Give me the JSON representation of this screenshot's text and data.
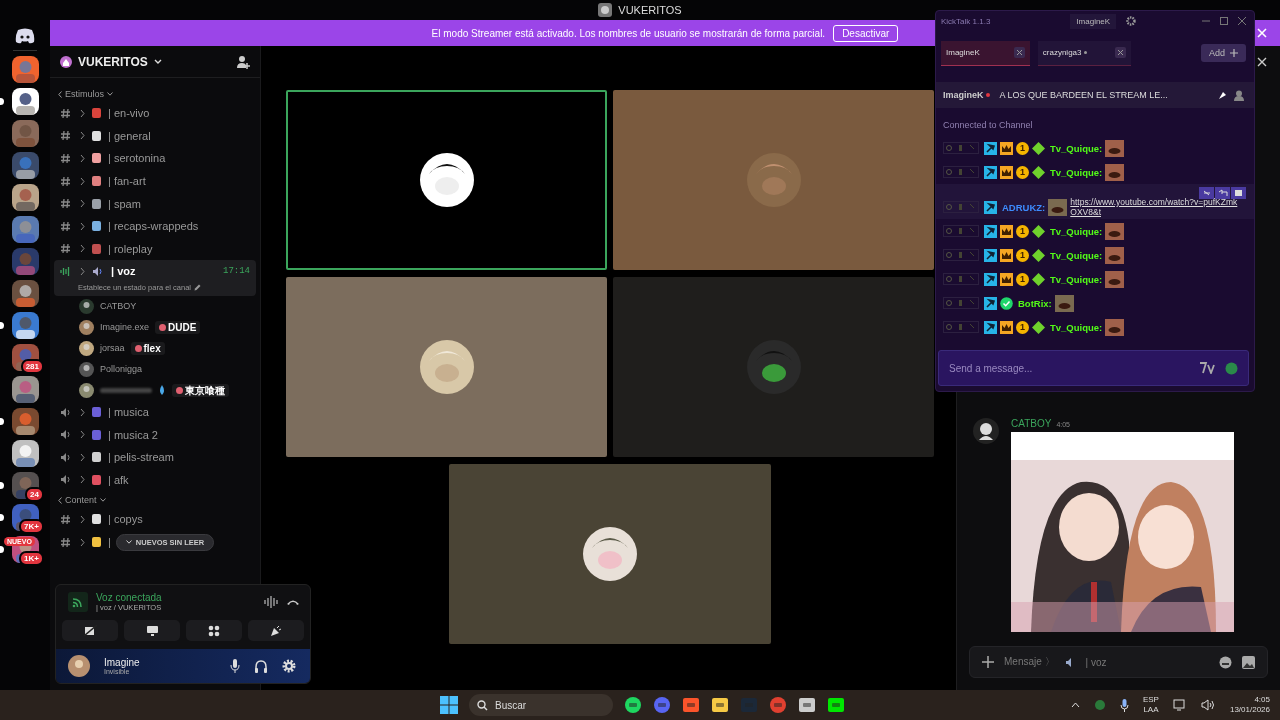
{
  "window": {
    "title": "VUKERITOS"
  },
  "banner": {
    "text": "El modo Streamer está activado. Los nombres de usuario se mostrarán de forma parcial.",
    "button": "Desactivar"
  },
  "servers": [
    {
      "unread": false
    },
    {
      "unread": true
    },
    {
      "unread": false
    },
    {
      "unread": false
    },
    {
      "unread": false
    },
    {
      "unread": false
    },
    {
      "unread": false
    },
    {
      "unread": false
    },
    {
      "unread": true
    },
    {
      "unread": false,
      "badge": "281"
    },
    {
      "unread": false
    },
    {
      "unread": true
    },
    {
      "unread": false
    },
    {
      "unread": true,
      "badge": "24"
    },
    {
      "unread": true,
      "badge": "7K+"
    },
    {
      "unread": true,
      "badge": "1K+"
    }
  ],
  "new_badge": "NUEVO",
  "sidebar": {
    "server": "VUKERITOS",
    "categories": [
      {
        "name": "Estimulos",
        "channels": [
          {
            "kind": "text",
            "name": "| en-vivo",
            "selected": false
          },
          {
            "kind": "text",
            "name": "| general",
            "selected": false
          },
          {
            "kind": "text",
            "name": "| serotonina",
            "selected": false
          },
          {
            "kind": "text",
            "name": "| fan-art",
            "selected": false
          },
          {
            "kind": "text",
            "name": "| spam",
            "selected": false
          },
          {
            "kind": "text",
            "name": "| recaps-wrappeds",
            "selected": false
          },
          {
            "kind": "text",
            "name": "| roleplay",
            "selected": false
          },
          {
            "kind": "voice",
            "name": "| voz",
            "selected": true,
            "time": "17:14",
            "status": "Establece un estado para el canal",
            "members": [
              {
                "kind": "user",
                "name": "CATBOY"
              },
              {
                "kind": "user",
                "name": "Imagine.exe",
                "tag": "DUDE"
              },
              {
                "kind": "user",
                "name": "jorsaa",
                "tag": "flex"
              },
              {
                "kind": "user",
                "name": "Pollonigga"
              },
              {
                "kind": "hidden",
                "tag": "東京喰種"
              }
            ]
          },
          {
            "kind": "voice",
            "name": "| musica",
            "selected": false
          },
          {
            "kind": "voice",
            "name": "| musica 2",
            "selected": false
          },
          {
            "kind": "voice",
            "name": "| pelis-stream",
            "selected": false
          },
          {
            "kind": "voice",
            "name": "| afk",
            "selected": false
          }
        ]
      },
      {
        "name": "Content",
        "channels": [
          {
            "kind": "text",
            "name": "| copys",
            "selected": false
          },
          {
            "kind": "text",
            "name": "|",
            "selected": false
          }
        ]
      }
    ],
    "unread_pill": "NUEVOS SIN LEER",
    "voice_panel": {
      "title": "Voz conectada",
      "channel": "| voz / VUKERITOS"
    },
    "user": {
      "name": "Imagine",
      "status": "Invisible"
    }
  },
  "tiles": [
    {
      "color": "#000000",
      "speaking": true
    },
    {
      "color": "#7a5a3e",
      "speaking": false
    },
    {
      "color": "#7c6d5d",
      "speaking": false
    },
    {
      "color": "#1f1e1c",
      "speaking": false
    },
    {
      "color": "#4a4435",
      "speaking": false
    }
  ],
  "kicktalk": {
    "title": "KickTalk 1.1.3",
    "user": "ImagineK",
    "tabs": [
      {
        "label": "ImagineK",
        "selected": true,
        "live": false
      },
      {
        "label": "crazyniga3",
        "selected": false,
        "live": true
      }
    ],
    "add": "Add",
    "pinned": {
      "user": "ImagineK",
      "text": "A LOS QUE BARDEEN EL STREAM LE..."
    },
    "status": "Connected to Channel",
    "messages": [
      {
        "user": "Tv_Quique:",
        "color": "#53fc18",
        "hovered": false,
        "badges": [
          {
            "kind": "mod"
          },
          {
            "kind": "crown"
          },
          {
            "kind": "sub",
            "label": "1"
          },
          {
            "kind": "og"
          }
        ]
      },
      {
        "user": "Tv_Quique:",
        "color": "#53fc18",
        "hovered": false,
        "badges": [
          {
            "kind": "mod"
          },
          {
            "kind": "crown"
          },
          {
            "kind": "sub",
            "label": "1"
          },
          {
            "kind": "og"
          }
        ]
      },
      {
        "user": "ADRUKZ:",
        "color": "#3d8bfd",
        "hovered": true,
        "badges": [
          {
            "kind": "mod"
          }
        ],
        "link": "https://www.youtube.com/watch?v=pufKZmkOXV8&t"
      },
      {
        "user": "Tv_Quique:",
        "color": "#53fc18",
        "hovered": false,
        "badges": [
          {
            "kind": "mod"
          },
          {
            "kind": "crown"
          },
          {
            "kind": "sub",
            "label": "1"
          },
          {
            "kind": "og"
          }
        ]
      },
      {
        "user": "Tv_Quique:",
        "color": "#53fc18",
        "hovered": false,
        "badges": [
          {
            "kind": "mod"
          },
          {
            "kind": "crown"
          },
          {
            "kind": "sub",
            "label": "1"
          },
          {
            "kind": "og"
          }
        ]
      },
      {
        "user": "Tv_Quique:",
        "color": "#53fc18",
        "hovered": false,
        "badges": [
          {
            "kind": "mod"
          },
          {
            "kind": "crown"
          },
          {
            "kind": "sub",
            "label": "1"
          },
          {
            "kind": "og"
          }
        ]
      },
      {
        "user": "BotRix:",
        "color": "#53fc18",
        "hovered": false,
        "badges": [
          {
            "kind": "mod"
          },
          {
            "kind": "verified"
          }
        ]
      },
      {
        "user": "Tv_Quique:",
        "color": "#53fc18",
        "hovered": false,
        "badges": [
          {
            "kind": "mod"
          },
          {
            "kind": "crown"
          },
          {
            "kind": "sub",
            "label": "1"
          },
          {
            "kind": "og"
          }
        ]
      }
    ],
    "placeholder": "Send a message..."
  },
  "chat": {
    "messages": [
      {
        "author": "CATBOY",
        "time": "4:05",
        "kind": "picture"
      }
    ],
    "input": {
      "prefix": "Mensaje 〉",
      "channel": "| voz"
    }
  },
  "taskbar": {
    "search": "Buscar",
    "language": "ESP",
    "layout": "LAA",
    "time": "4:05",
    "date": "13/01/2026"
  }
}
